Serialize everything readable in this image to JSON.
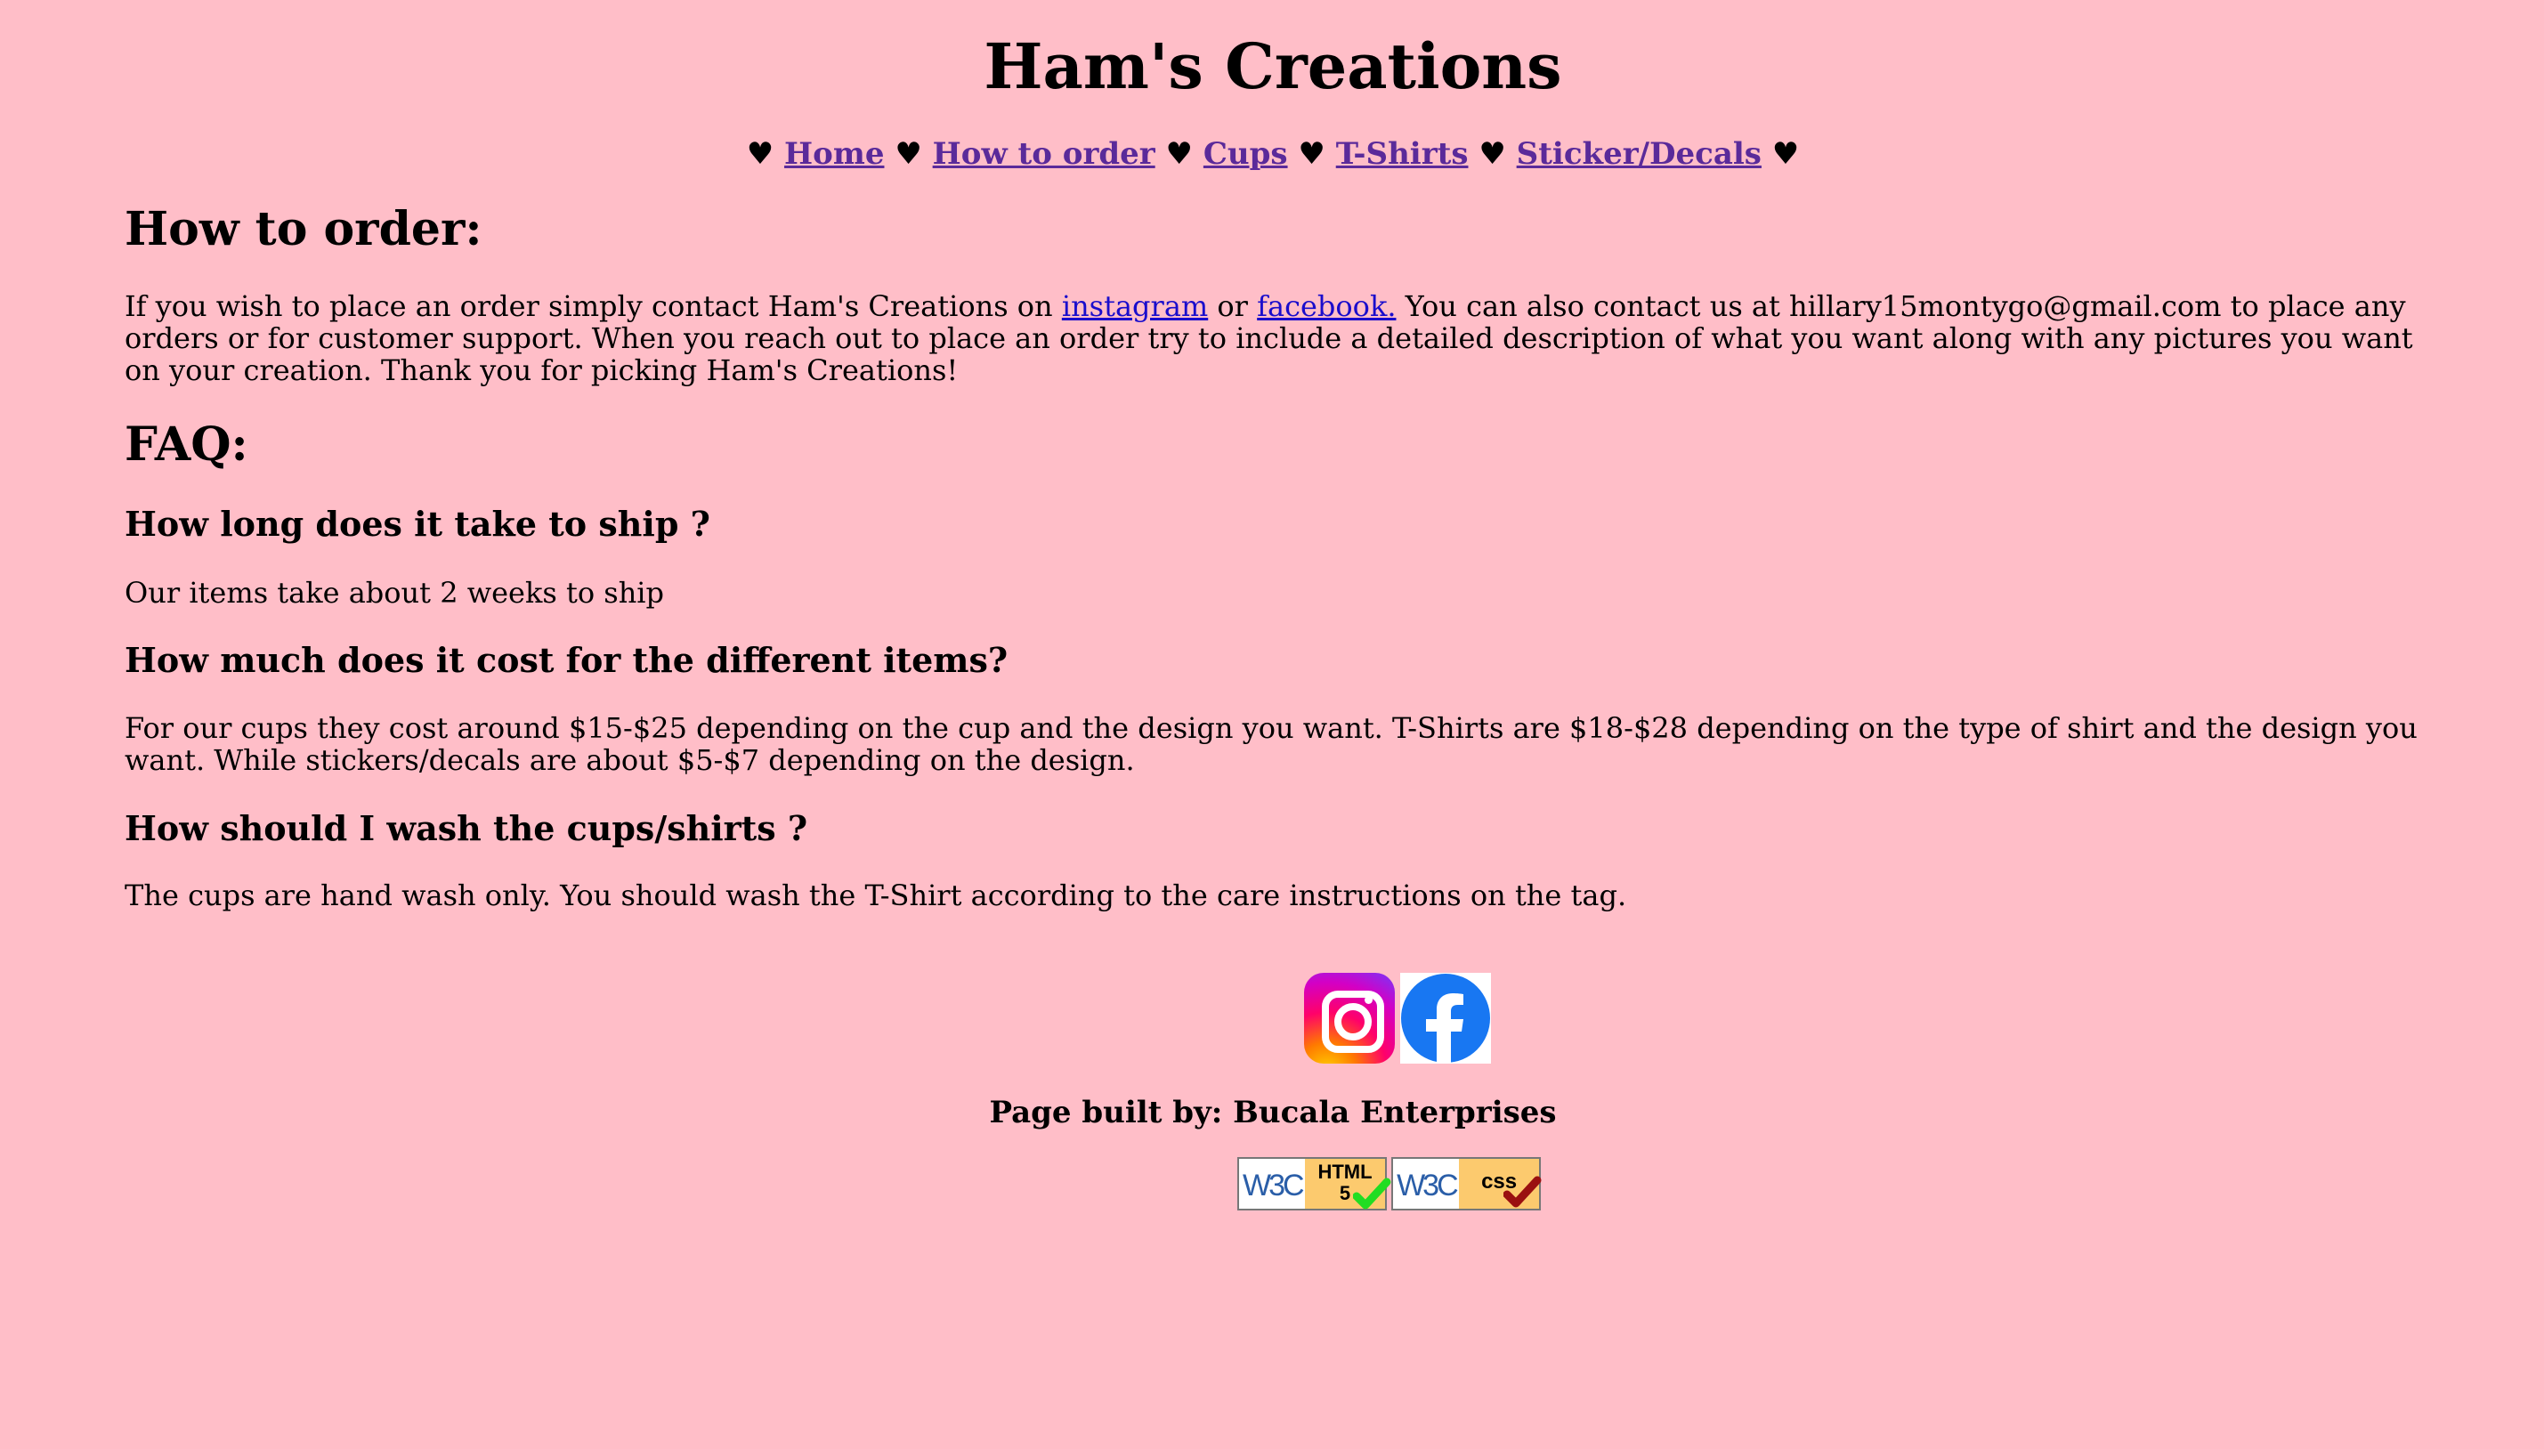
{
  "header": {
    "title": "Ham's Creations"
  },
  "nav": {
    "separator": "♥",
    "items": [
      {
        "label": "Home"
      },
      {
        "label": "How to order"
      },
      {
        "label": "Cups"
      },
      {
        "label": "T-Shirts"
      },
      {
        "label": "Sticker/Decals"
      }
    ]
  },
  "order": {
    "heading": "How to order:",
    "text_before": "If you wish to place an order simply contact Ham's Creations on ",
    "instagram_link": "instagram",
    "text_or": " or ",
    "facebook_link": "facebook.",
    "text_after": " You can also contact us at hillary15montygo@gmail.com to place any orders or for customer support. When you reach out to place an order try to include a detailed description of what you want along with any pictures you want on your creation. Thank you for picking Ham's Creations!"
  },
  "faq": {
    "heading": "FAQ:",
    "items": [
      {
        "question": "How long does it take to ship ?",
        "answer": "Our items take about 2 weeks to ship"
      },
      {
        "question": "How much does it cost for the different items?",
        "answer": "For our cups they cost around $15-$25 depending on the cup and the design you want. T-Shirts are $18-$28 depending on the type of shirt and the design you want. While stickers/decals are about $5-$7 depending on the design."
      },
      {
        "question": "How should I wash the cups/shirts ?",
        "answer": "The cups are hand wash only. You should wash the T-Shirt according to the care instructions on the tag."
      }
    ]
  },
  "footer": {
    "social_icons": [
      "instagram-icon",
      "facebook-icon"
    ],
    "built_by": "Page built by: Bucala Enterprises",
    "badges": [
      {
        "org": "W3C",
        "line1": "HTML",
        "line2": "5"
      },
      {
        "org": "W3C",
        "line1": "css",
        "line2": ""
      }
    ]
  },
  "colors": {
    "background": "#ffbec8",
    "nav_link": "#5a2a9a",
    "body_link": "#1a0dcc",
    "facebook_blue": "#1877f2"
  }
}
